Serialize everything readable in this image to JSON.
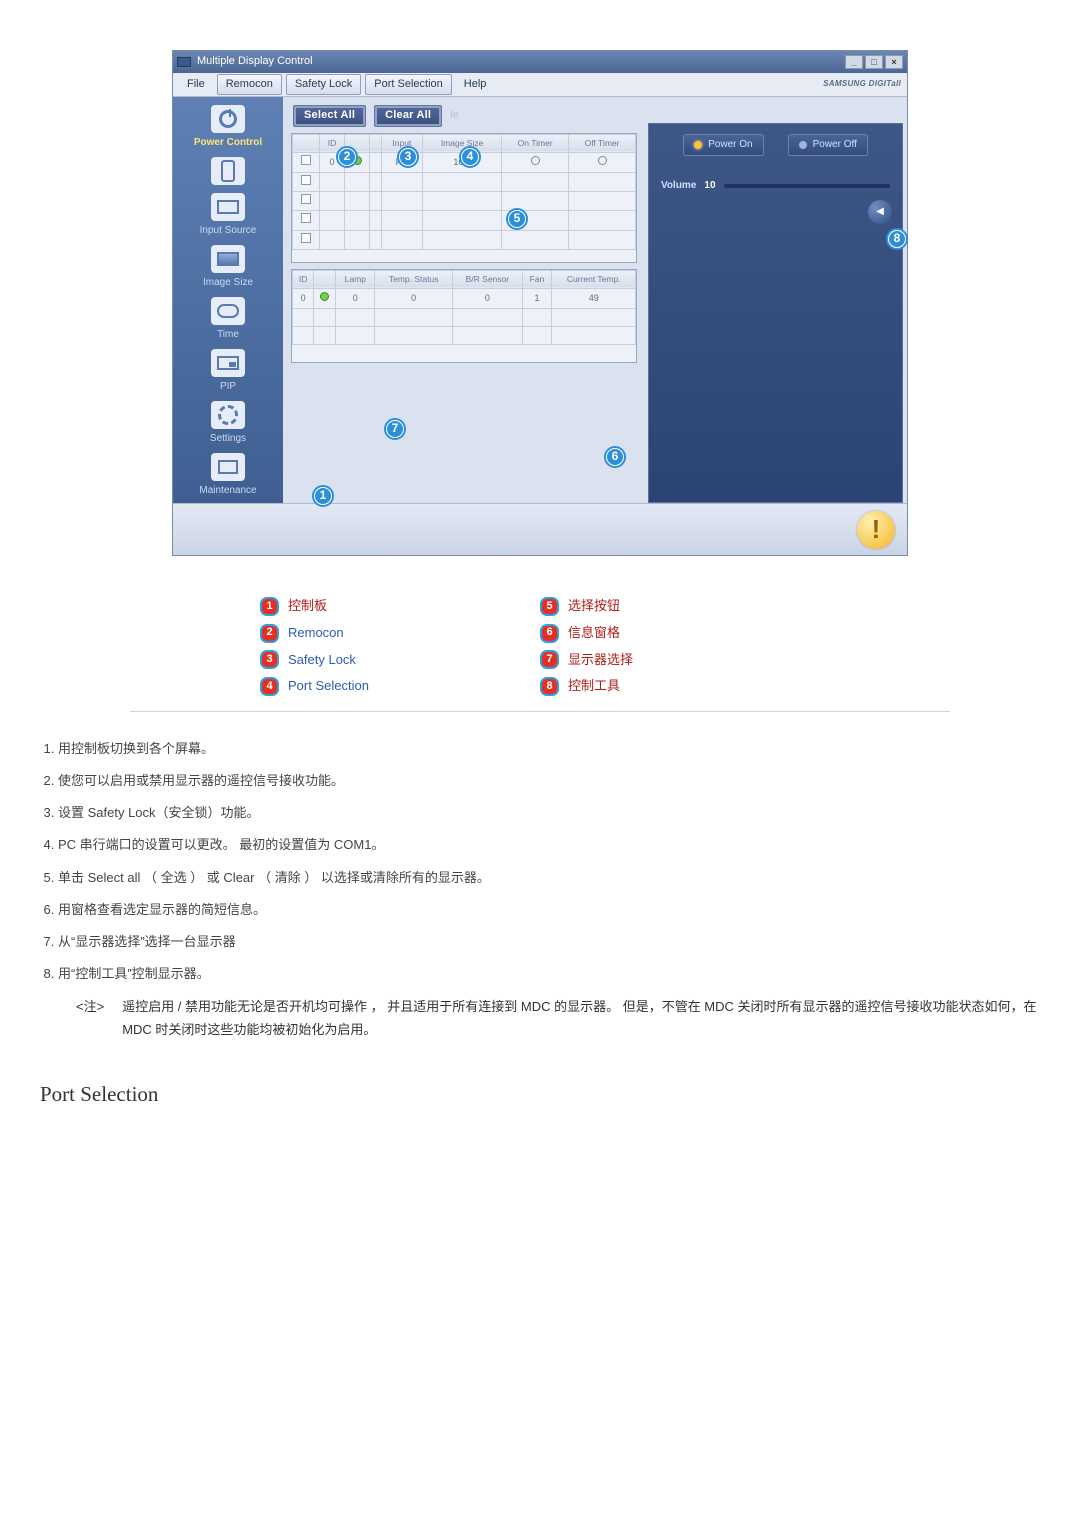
{
  "titlebar": {
    "title": "Multiple Display Control"
  },
  "win_controls": {
    "min": "_",
    "max": "□",
    "close": "×"
  },
  "menubar": {
    "file": "File",
    "remocon": "Remocon",
    "safety_lock": "Safety Lock",
    "port_selection": "Port Selection",
    "help": "Help",
    "brand": "SAMSUNG DIGITall"
  },
  "sidebar": {
    "items": [
      {
        "label": "Power Control"
      },
      {
        "label": ""
      },
      {
        "label": "Input Source"
      },
      {
        "label": "Image Size"
      },
      {
        "label": "Time"
      },
      {
        "label": "PIP"
      },
      {
        "label": "Settings"
      },
      {
        "label": "Maintenance"
      }
    ]
  },
  "toolbar": {
    "select_all": "Select All",
    "clear_all": "Clear All",
    "trailing": "le"
  },
  "top_grid": {
    "headers": [
      "",
      "ID",
      "",
      "",
      "Input",
      "Image Size",
      "On Timer",
      "Off Timer"
    ],
    "row": {
      "id": "0",
      "input": "PC",
      "image_size": "16:9"
    }
  },
  "bottom_grid": {
    "headers": [
      "ID",
      "",
      "Lamp",
      "Temp. Status",
      "B/R Sensor",
      "Fan",
      "Current Temp."
    ],
    "row": {
      "id": "0",
      "lamp": "0",
      "temp_status": "0",
      "br_sensor": "0",
      "fan": "1",
      "cur_temp": "49"
    }
  },
  "right_panel": {
    "power_on": "Power On",
    "power_off": "Power Off",
    "volume_label": "Volume",
    "volume_value": "10"
  },
  "status_icon_glyph": "!",
  "badges": [
    "1",
    "2",
    "3",
    "4",
    "5",
    "6",
    "7",
    "8"
  ],
  "legend": [
    {
      "num": "1",
      "text": "控制板",
      "cls": "red"
    },
    {
      "num": "2",
      "text": "Remocon",
      "cls": "blue"
    },
    {
      "num": "3",
      "text": "Safety Lock",
      "cls": "blue"
    },
    {
      "num": "4",
      "text": "Port Selection",
      "cls": "blue"
    },
    {
      "num": "5",
      "text": "选择按钮",
      "cls": "red"
    },
    {
      "num": "6",
      "text": "信息窗格",
      "cls": "red"
    },
    {
      "num": "7",
      "text": "显示器选择",
      "cls": "red"
    },
    {
      "num": "8",
      "text": "控制工具",
      "cls": "red"
    }
  ],
  "notes": {
    "n1": "用控制板切换到各个屏幕。",
    "n2": "使您可以启用或禁用显示器的遥控信号接收功能。",
    "n3": "设置 Safety Lock（安全锁）功能。",
    "n4": "PC 串行端口的设置可以更改。 最初的设置值为 COM1。",
    "n5": "单击 Select all （ 全选 ） 或 Clear （ 清除 ） 以选择或清除所有的显示器。",
    "n6": "用窗格查看选定显示器的简短信息。",
    "n7": "从“显示器选择”选择一台显示器",
    "n8": "用“控制工具”控制显示器。"
  },
  "footnote": {
    "tag": "<注>",
    "text": "遥控启用 / 禁用功能无论是否开机均可操作 ， 并且适用于所有连接到 MDC 的显示器。 但是，不管在 MDC 关闭时所有显示器的遥控信号接收功能状态如何，在 MDC 时关闭时这些功能均被初始化为启用。"
  },
  "section_heading": "Port Selection"
}
